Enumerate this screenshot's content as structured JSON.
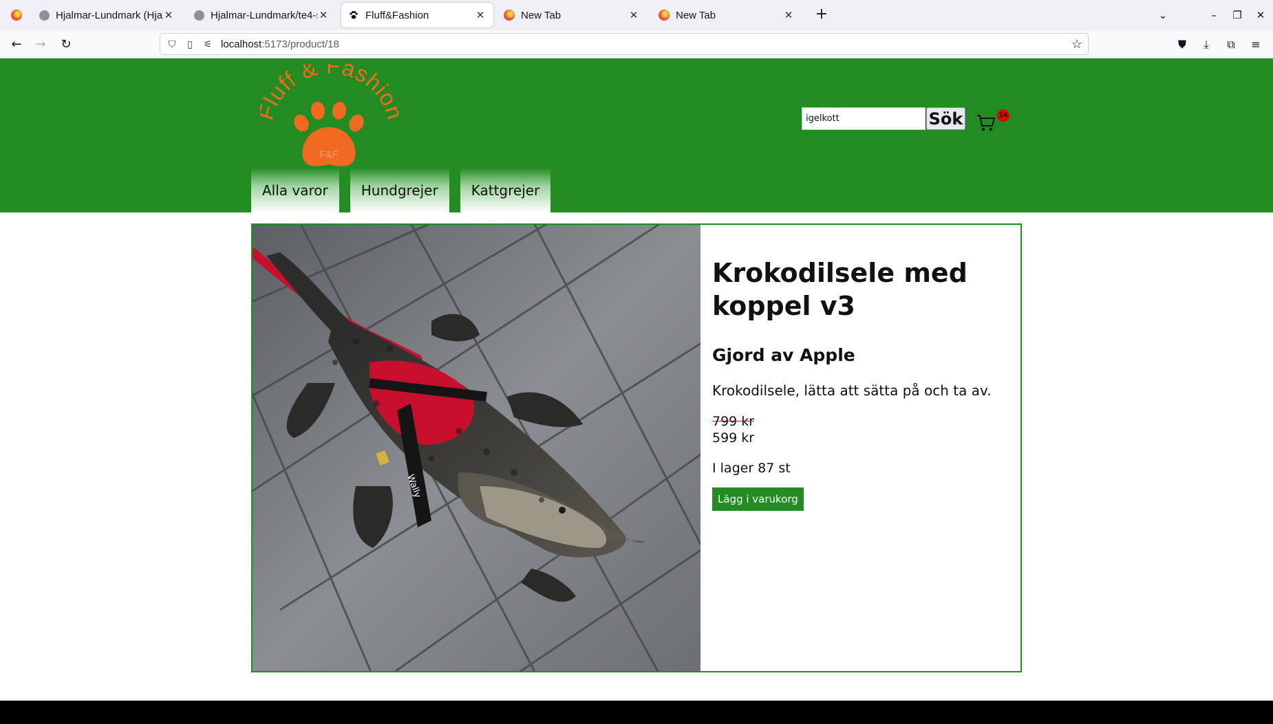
{
  "browser": {
    "tabs": [
      {
        "label": "Hjalmar-Lundmark (Hjalm",
        "icon": "github-icon",
        "active": false
      },
      {
        "label": "Hjalmar-Lundmark/te4-sl",
        "icon": "github-icon",
        "active": false
      },
      {
        "label": "Fluff&Fashion",
        "icon": "paw-icon",
        "active": true
      },
      {
        "label": "New Tab",
        "icon": "firefox-icon",
        "active": false
      },
      {
        "label": "New Tab",
        "icon": "firefox-icon",
        "active": false
      }
    ],
    "url_host": "localhost",
    "url_path": ":5173/product/18"
  },
  "site": {
    "logo_text_top": "Fluff & Fashion",
    "logo_badge": "F&F",
    "brand_color": "#228b22",
    "accent_color": "#f26a21",
    "search": {
      "value": "igelkott",
      "button_label": "Sök"
    },
    "cart": {
      "count": "14"
    },
    "categories": [
      "Alla varor",
      "Hundgrejer",
      "Kattgrejer"
    ]
  },
  "product": {
    "title": "Krokodilsele med koppel v3",
    "brand": "Gjord av Apple",
    "description": "Krokodilsele, lätta att sätta på och ta av.",
    "old_price": "799 kr",
    "price": "599 kr",
    "stock": "I lager 87 st",
    "add_to_cart_label": "Lägg i varukorg",
    "harness_tag_text": "Wally"
  }
}
